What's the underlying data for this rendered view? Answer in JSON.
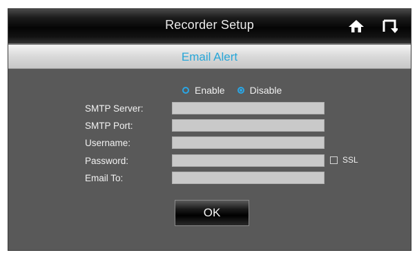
{
  "header": {
    "title": "Recorder Setup",
    "icons": [
      "home-icon",
      "back-icon"
    ]
  },
  "section": {
    "title": "Email Alert"
  },
  "alert_mode": {
    "options": [
      {
        "label": "Enable",
        "selected": false
      },
      {
        "label": "Disable",
        "selected": true
      }
    ]
  },
  "form": {
    "smtp_server": {
      "label": "SMTP Server:",
      "value": ""
    },
    "smtp_port": {
      "label": "SMTP Port:",
      "value": ""
    },
    "username": {
      "label": "Username:",
      "value": ""
    },
    "password": {
      "label": "Password:",
      "value": ""
    },
    "email_to": {
      "label": "Email To:",
      "value": ""
    },
    "ssl": {
      "label": "SSL",
      "checked": false
    }
  },
  "actions": {
    "ok_label": "OK"
  },
  "colors": {
    "accent": "#27a6d8",
    "panel": "#595959",
    "field": "#c9c9c9"
  }
}
